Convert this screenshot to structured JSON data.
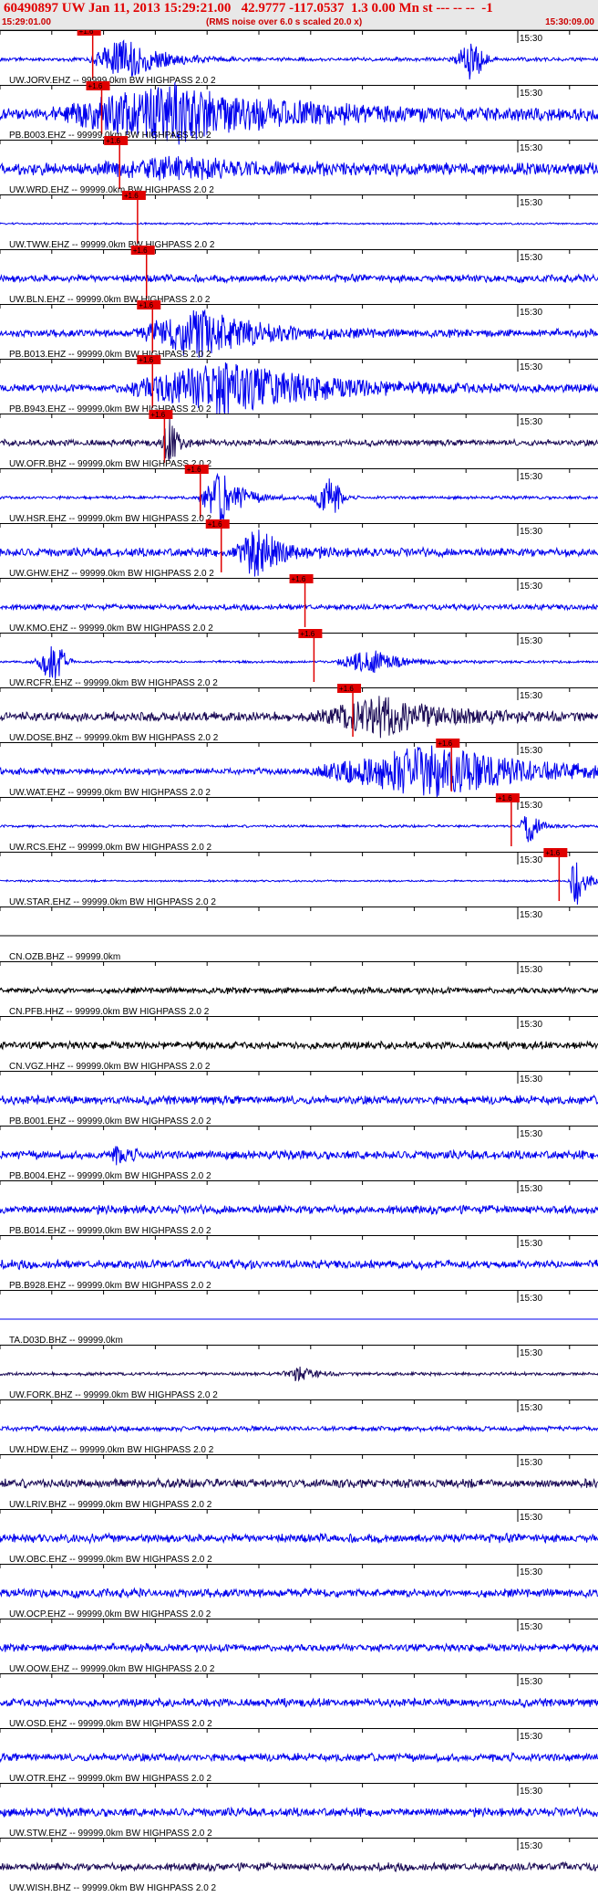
{
  "header": {
    "title": "60490897 UW Jan 11, 2013 15:29:21.00   42.9777 -117.0537  1.3 0.00 Mn st --- -- --  -1",
    "start_time": "15:29:01.00",
    "note": "(RMS noise over 6.0 s scaled 20.0 x)",
    "end_time": "15:30:09.00"
  },
  "tick_label": "15:30",
  "pick_label": "+1.6",
  "colors": {
    "blue": "#0000ee",
    "navy": "#1a0a55",
    "black": "#000000",
    "pick": "#e00000",
    "axis": "#000000"
  },
  "traces": [
    {
      "label": "UW.JORV.EHZ -- 99999.0km BW  HIGHPASS  2.0  2",
      "color": "blue",
      "pick": 0.155,
      "burst": 0.21,
      "burstWidth": 0.11,
      "amp": 0.85,
      "noise": 0.06,
      "extra": 0.79
    },
    {
      "label": "PB.B003.EHZ -- 99999.0km BW  HIGHPASS  2.0  2",
      "color": "blue",
      "pick": 0.17,
      "burst": 0.29,
      "burstWidth": 0.36,
      "amp": 1.0,
      "noise": 0.2,
      "extra": null
    },
    {
      "label": "UW.WRD.EHZ -- 99999.0km BW  HIGHPASS  2.0  2",
      "color": "blue",
      "pick": 0.2,
      "burst": 0.3,
      "burstWidth": 0.25,
      "amp": 0.3,
      "noise": 0.2,
      "extra": null
    },
    {
      "label": "UW.TWW.EHZ -- 99999.0km BW  HIGHPASS  2.0  2",
      "color": "blue",
      "pick": 0.23,
      "burst": null,
      "burstWidth": 0,
      "amp": 0.3,
      "noise": 0.03,
      "extra": null
    },
    {
      "label": "UW.BLN.EHZ -- 99999.0km BW  HIGHPASS  2.0  2",
      "color": "blue",
      "pick": 0.245,
      "burst": null,
      "burstWidth": 0,
      "amp": 0.2,
      "noise": 0.12,
      "extra": null
    },
    {
      "label": "PB.B013.EHZ -- 99999.0km BW  HIGHPASS  2.0  2",
      "color": "blue",
      "pick": 0.255,
      "burst": 0.34,
      "burstWidth": 0.2,
      "amp": 1.0,
      "noise": 0.12,
      "extra": null
    },
    {
      "label": "PB.B943.EHZ -- 99999.0km BW  HIGHPASS  2.0  2",
      "color": "blue",
      "pick": 0.255,
      "burst": 0.38,
      "burstWidth": 0.32,
      "amp": 1.0,
      "noise": 0.12,
      "extra": null
    },
    {
      "label": "UW.OFR.BHZ -- 99999.0km BW  HIGHPASS  2.0  2",
      "color": "navy",
      "pick": 0.275,
      "burst": 0.285,
      "burstWidth": 0.03,
      "amp": 0.9,
      "noise": 0.1,
      "extra": null
    },
    {
      "label": "UW.HSR.EHZ -- 99999.0km BW  HIGHPASS  2.0  2",
      "color": "blue",
      "pick": 0.335,
      "burst": 0.37,
      "burstWidth": 0.07,
      "amp": 1.0,
      "noise": 0.05,
      "extra": 0.55
    },
    {
      "label": "UW.GHW.EHZ -- 99999.0km BW  HIGHPASS  2.0  2",
      "color": "blue",
      "pick": 0.37,
      "burst": 0.43,
      "burstWidth": 0.08,
      "amp": 1.0,
      "noise": 0.14,
      "extra": null
    },
    {
      "label": "UW.KMO.EHZ -- 99999.0km BW  HIGHPASS  2.0  2",
      "color": "blue",
      "pick": 0.51,
      "burst": null,
      "burstWidth": 0,
      "amp": 0.2,
      "noise": 0.09,
      "extra": null
    },
    {
      "label": "UW.RCFR.EHZ -- 99999.0km BW  HIGHPASS  2.0  2",
      "color": "blue",
      "pick": 0.525,
      "burst": 0.62,
      "burstWidth": 0.1,
      "amp": 0.5,
      "noise": 0.04,
      "extra": 0.09
    },
    {
      "label": "UW.DOSE.BHZ -- 99999.0km BW  HIGHPASS  2.0  2",
      "color": "navy",
      "pick": 0.59,
      "burst": 0.64,
      "burstWidth": 0.2,
      "amp": 0.7,
      "noise": 0.15,
      "extra": null
    },
    {
      "label": "UW.WAT.EHZ -- 99999.0km BW  HIGHPASS  2.0  2",
      "color": "blue",
      "pick": 0.755,
      "burst": 0.72,
      "burstWidth": 0.35,
      "amp": 1.0,
      "noise": 0.1,
      "extra": null
    },
    {
      "label": "UW.RCS.EHZ -- 99999.0km BW  HIGHPASS  2.0  2",
      "color": "blue",
      "pick": 0.855,
      "burst": 0.885,
      "burstWidth": 0.03,
      "amp": 0.8,
      "noise": 0.04,
      "extra": null
    },
    {
      "label": "UW.STAR.EHZ -- 99999.0km BW  HIGHPASS  2.0  2",
      "color": "blue",
      "pick": 0.935,
      "burst": 0.965,
      "burstWidth": 0.03,
      "amp": 1.0,
      "noise": 0.03,
      "extra": null
    },
    {
      "label": "CN.OZB.BHZ -- 99999.0km",
      "color": "black",
      "pick": null,
      "burst": null,
      "burstWidth": 0,
      "amp": 0,
      "noise": 0.0,
      "extra": null
    },
    {
      "label": "CN.PFB.HHZ -- 99999.0km BW  HIGHPASS  2.0  2",
      "color": "black",
      "pick": null,
      "burst": null,
      "burstWidth": 0,
      "amp": 0,
      "noise": 0.1,
      "extra": null
    },
    {
      "label": "CN.VGZ.HHZ -- 99999.0km BW  HIGHPASS  2.0  2",
      "color": "black",
      "pick": null,
      "burst": null,
      "burstWidth": 0,
      "amp": 0,
      "noise": 0.12,
      "extra": null
    },
    {
      "label": "PB.B001.EHZ -- 99999.0km BW  HIGHPASS  2.0  2",
      "color": "blue",
      "pick": null,
      "burst": null,
      "burstWidth": 0,
      "amp": 0,
      "noise": 0.14,
      "extra": null
    },
    {
      "label": "PB.B004.EHZ -- 99999.0km BW  HIGHPASS  2.0  2",
      "color": "blue",
      "pick": null,
      "burst": 0.2,
      "burstWidth": 0.04,
      "amp": 0.3,
      "noise": 0.14,
      "extra": null
    },
    {
      "label": "PB.B014.EHZ -- 99999.0km BW  HIGHPASS  2.0  2",
      "color": "blue",
      "pick": null,
      "burst": null,
      "burstWidth": 0,
      "amp": 0,
      "noise": 0.14,
      "extra": null
    },
    {
      "label": "PB.B928.EHZ -- 99999.0km BW  HIGHPASS  2.0  2",
      "color": "blue",
      "pick": null,
      "burst": null,
      "burstWidth": 0,
      "amp": 0,
      "noise": 0.14,
      "extra": null
    },
    {
      "label": "TA.D03D.BHZ -- 99999.0km",
      "color": "blue",
      "pick": null,
      "burst": null,
      "burstWidth": 0,
      "amp": 0,
      "noise": 0.0,
      "extra": null
    },
    {
      "label": "UW.FORK.BHZ -- 99999.0km BW  HIGHPASS  2.0  2",
      "color": "navy",
      "pick": null,
      "burst": 0.5,
      "burstWidth": 0.05,
      "amp": 0.3,
      "noise": 0.05,
      "extra": null
    },
    {
      "label": "UW.HDW.EHZ -- 99999.0km BW  HIGHPASS  2.0  2",
      "color": "blue",
      "pick": null,
      "burst": null,
      "burstWidth": 0,
      "amp": 0,
      "noise": 0.08,
      "extra": null
    },
    {
      "label": "UW.LRIV.BHZ -- 99999.0km BW  HIGHPASS  2.0  2",
      "color": "navy",
      "pick": null,
      "burst": null,
      "burstWidth": 0,
      "amp": 0,
      "noise": 0.14,
      "extra": null
    },
    {
      "label": "UW.OBC.EHZ -- 99999.0km BW  HIGHPASS  2.0  2",
      "color": "blue",
      "pick": null,
      "burst": null,
      "burstWidth": 0,
      "amp": 0,
      "noise": 0.14,
      "extra": null
    },
    {
      "label": "UW.OCP.EHZ -- 99999.0km BW  HIGHPASS  2.0  2",
      "color": "blue",
      "pick": null,
      "burst": null,
      "burstWidth": 0,
      "amp": 0,
      "noise": 0.14,
      "extra": null
    },
    {
      "label": "UW.OOW.EHZ -- 99999.0km BW  HIGHPASS  2.0  2",
      "color": "blue",
      "pick": null,
      "burst": null,
      "burstWidth": 0,
      "amp": 0,
      "noise": 0.12,
      "extra": null
    },
    {
      "label": "UW.OSD.EHZ -- 99999.0km BW  HIGHPASS  2.0  2",
      "color": "blue",
      "pick": null,
      "burst": null,
      "burstWidth": 0,
      "amp": 0,
      "noise": 0.13,
      "extra": null
    },
    {
      "label": "UW.OTR.EHZ -- 99999.0km BW  HIGHPASS  2.0  2",
      "color": "blue",
      "pick": null,
      "burst": null,
      "burstWidth": 0,
      "amp": 0,
      "noise": 0.13,
      "extra": null
    },
    {
      "label": "UW.STW.EHZ -- 99999.0km BW  HIGHPASS  2.0  2",
      "color": "blue",
      "pick": null,
      "burst": null,
      "burstWidth": 0,
      "amp": 0,
      "noise": 0.14,
      "extra": null
    },
    {
      "label": "UW.WISH.BHZ -- 99999.0km BW  HIGHPASS  2.0  2",
      "color": "navy",
      "pick": null,
      "burst": null,
      "burstWidth": 0,
      "amp": 0,
      "noise": 0.13,
      "extra": null
    }
  ]
}
